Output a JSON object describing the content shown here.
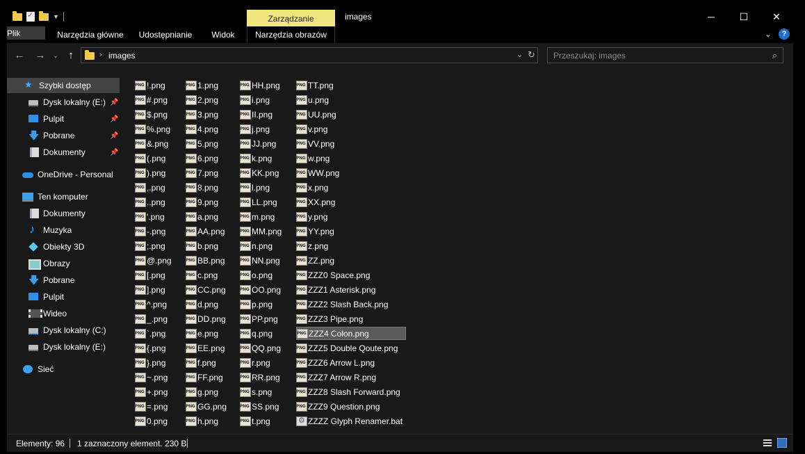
{
  "window": {
    "title": "images",
    "context_tab": "Zarządzanie",
    "buttons": {
      "minimize": "─",
      "maximize": "☐",
      "close": "✕"
    }
  },
  "ribbon": {
    "tabs": [
      "Plik",
      "Narzędzia główne",
      "Udostępnianie",
      "Widok",
      "Narzędzia obrazów"
    ]
  },
  "address": {
    "path": "images",
    "search_placeholder": "Przeszukaj: images"
  },
  "sidebar": {
    "items": [
      {
        "label": "Szybki dostęp",
        "icon": "star-icon",
        "pinned": false
      },
      {
        "label": "Dysk lokalny (E:)",
        "icon": "drive-icon",
        "pinned": true
      },
      {
        "label": "Pulpit",
        "icon": "desktop-icon",
        "pinned": true
      },
      {
        "label": "Pobrane",
        "icon": "download-icon",
        "pinned": true
      },
      {
        "label": "Dokumenty",
        "icon": "documents-icon",
        "pinned": true
      },
      {
        "label": "OneDrive - Personal",
        "icon": "cloud-icon",
        "pinned": false
      },
      {
        "label": "Ten komputer",
        "icon": "computer-icon",
        "pinned": false
      },
      {
        "label": "Dokumenty",
        "icon": "documents-icon",
        "pinned": false
      },
      {
        "label": "Muzyka",
        "icon": "music-icon",
        "pinned": false
      },
      {
        "label": "Obiekty 3D",
        "icon": "objects-3d-icon",
        "pinned": false
      },
      {
        "label": "Obrazy",
        "icon": "pictures-icon",
        "pinned": false
      },
      {
        "label": "Pobrane",
        "icon": "download-icon",
        "pinned": false
      },
      {
        "label": "Pulpit",
        "icon": "desktop-icon",
        "pinned": false
      },
      {
        "label": "Wideo",
        "icon": "video-icon",
        "pinned": false
      },
      {
        "label": "Dysk lokalny (C:)",
        "icon": "system-drive-icon",
        "pinned": false
      },
      {
        "label": "Dysk lokalny (E:)",
        "icon": "drive-icon",
        "pinned": false
      },
      {
        "label": "Sieć",
        "icon": "network-icon",
        "pinned": false
      }
    ]
  },
  "files": {
    "columns": [
      [
        "!.png",
        "#.png",
        "$.png",
        "%.png",
        "&.png",
        "(.png",
        ").png",
        ",.png",
        "..png",
        "'.png",
        "-.png",
        ";.png",
        "@.png",
        "[.png",
        "].png",
        "^.png",
        "_.png",
        "`.png",
        "{.png",
        "}.png",
        "~.png",
        "+.png",
        "=.png",
        "0.png"
      ],
      [
        "1.png",
        "2.png",
        "3.png",
        "4.png",
        "5.png",
        "6.png",
        "7.png",
        "8.png",
        "9.png",
        "a.png",
        "AA.png",
        "b.png",
        "BB.png",
        "c.png",
        "CC.png",
        "d.png",
        "DD.png",
        "e.png",
        "EE.png",
        "f.png",
        "FF.png",
        "g.png",
        "GG.png",
        "h.png"
      ],
      [
        "HH.png",
        "i.png",
        "II.png",
        "j.png",
        "JJ.png",
        "k.png",
        "KK.png",
        "l.png",
        "LL.png",
        "m.png",
        "MM.png",
        "n.png",
        "NN.png",
        "o.png",
        "OO.png",
        "p.png",
        "PP.png",
        "q.png",
        "QQ.png",
        "r.png",
        "RR.png",
        "s.png",
        "SS.png",
        "t.png"
      ],
      [
        "TT.png",
        "u.png",
        "UU.png",
        "v.png",
        "VV.png",
        "w.png",
        "WW.png",
        "x.png",
        "XX.png",
        "y.png",
        "YY.png",
        "z.png",
        "ZZ.png",
        "ZZZ0 Space.png",
        "ZZZ1 Asterisk.png",
        "ZZZ2 Slash Back.png",
        "ZZZ3 Pipe.png",
        "ZZZ4 Colon.png",
        "ZZZ5 Double Qoute.png",
        "ZZZ6 Arrow L.png",
        "ZZZ7 Arrow R.png",
        "ZZZ8 Slash Forward.png",
        "ZZZ9 Question.png",
        "ZZZZ Glyph Renamer.bat"
      ]
    ],
    "selected": "ZZZ4 Colon.png"
  },
  "status": {
    "count": "Elementy: 96",
    "selection": "1 zaznaczony element. 230 B"
  }
}
